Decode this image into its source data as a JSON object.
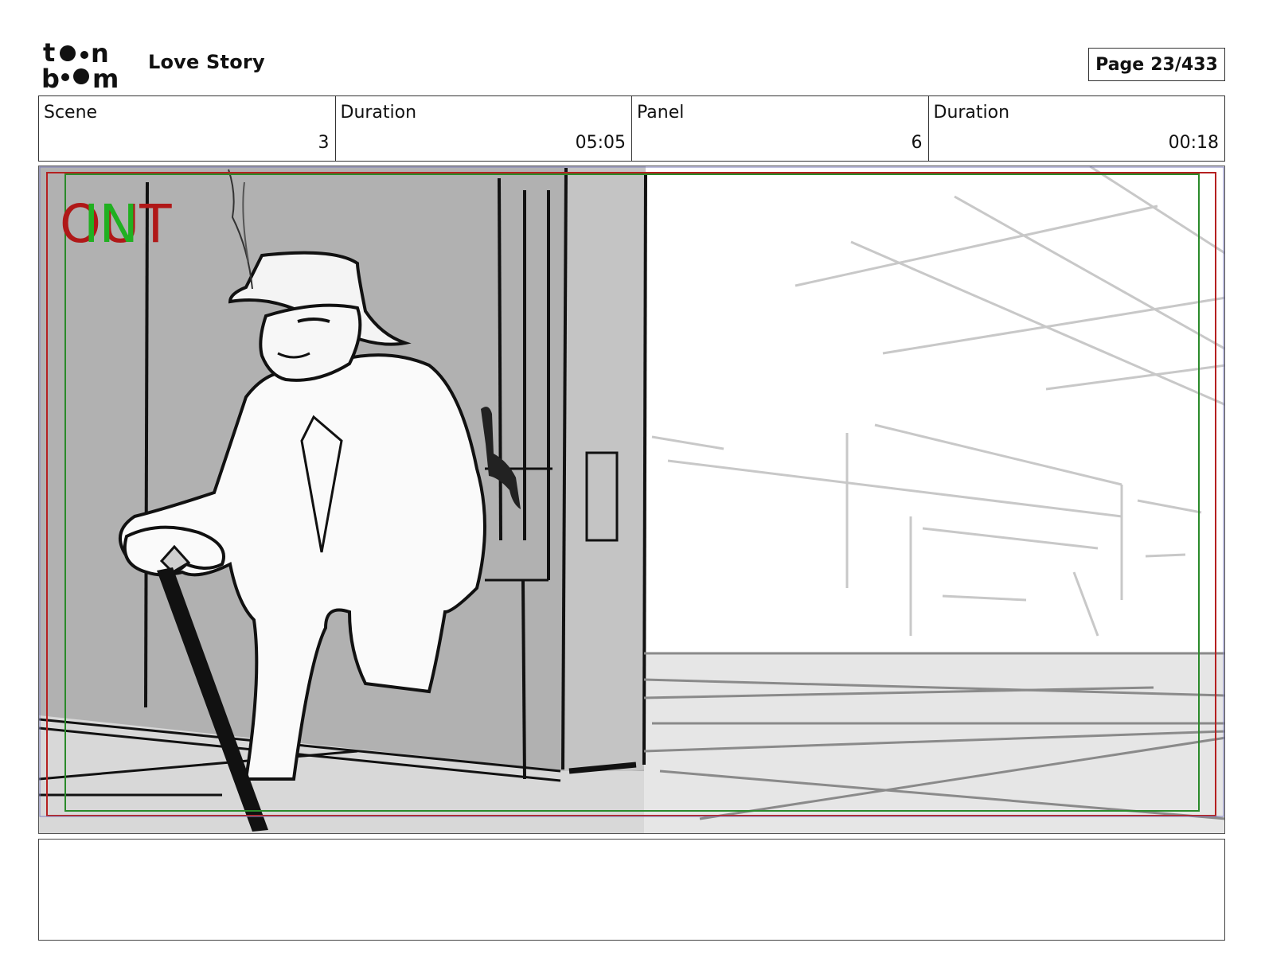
{
  "header": {
    "logo_text": "toon boom",
    "project_title": "Love Story",
    "page_label": "Page",
    "page_number": "23/433"
  },
  "info_bar": {
    "scene_label": "Scene",
    "scene_value": "3",
    "scene_duration_label": "Duration",
    "scene_duration_value": "05:05",
    "panel_label": "Panel",
    "panel_value": "6",
    "panel_duration_label": "Duration",
    "panel_duration_value": "00:18"
  },
  "panel": {
    "marker_out": "OUT",
    "marker_in": "IN",
    "colors": {
      "out_marker": "#b01818",
      "in_marker": "#21b021",
      "safe_frame_red": "#b52020",
      "safe_frame_green": "#2a8a2a",
      "door_gray": "#b1b1b1",
      "floor_gray": "#e6e6e6"
    }
  },
  "notes": {
    "text": ""
  }
}
